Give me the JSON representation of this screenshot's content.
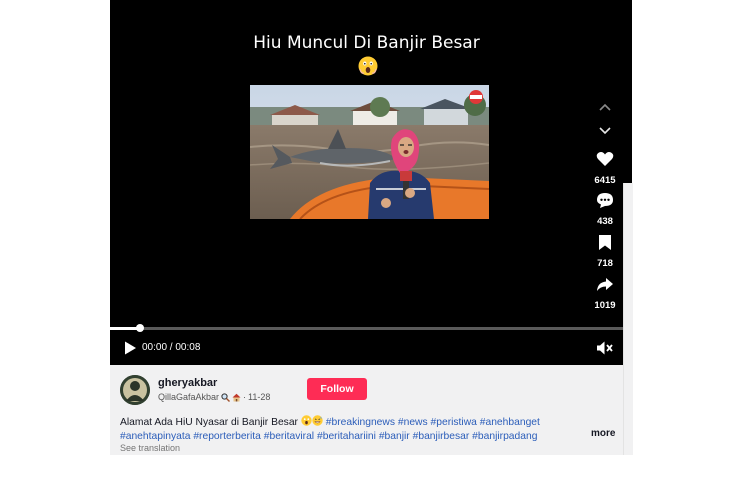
{
  "video": {
    "title": "Hiu Muncul Di Banjir Besar",
    "time": "00:00 / 00:08",
    "progress": 0.058
  },
  "actions": {
    "likes": "6415",
    "comments": "438",
    "saves": "718",
    "shares": "1019"
  },
  "author": {
    "username": "gheryakbar",
    "nickname": "QillaGafaAkbar",
    "date": "11-28",
    "separator": "·"
  },
  "follow_label": "Follow",
  "description": {
    "text": "Alamat Ada HiU Nyasar di Banjir Besar",
    "hashtags_line1": [
      "#breakingnews",
      "#news",
      "#peristiwa",
      "#anehbanget"
    ],
    "hashtags_line2": [
      "#anehtapinyata",
      "#reporterberita",
      "#beritaviral",
      "#beritahariini",
      "#banjir",
      "#banjirbesar",
      "#banjirpadang"
    ]
  },
  "more_label": "more",
  "see_translation": "See translation",
  "colors": {
    "accent": "#fe2c55",
    "hashtag": "#2b5db9",
    "background": "#f1f1f2"
  },
  "icons": [
    "chevron-up-icon",
    "chevron-down-icon",
    "heart-icon",
    "comment-icon",
    "bookmark-icon",
    "share-icon",
    "play-icon",
    "mute-icon",
    "screaming-face-emoji",
    "grinning-sweat-emoji"
  ]
}
